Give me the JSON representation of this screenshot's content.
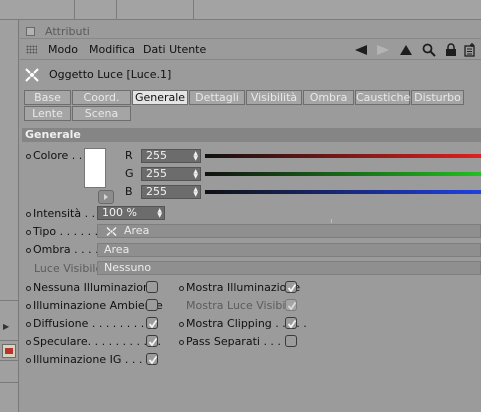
{
  "window": {
    "title": "Attributi"
  },
  "menubar": {
    "items": [
      "Modo",
      "Modifica",
      "Dati Utente"
    ]
  },
  "object": {
    "name": "Oggetto Luce [Luce.1]"
  },
  "tabs": {
    "row1": [
      "Base",
      "Coord.",
      "Generale",
      "Dettagli",
      "Visibilità",
      "Ombra",
      "Caustiche",
      "Disturbo"
    ],
    "row2": [
      "Lente",
      "Scena"
    ],
    "active": "Generale"
  },
  "section": {
    "title": "Generale"
  },
  "color": {
    "label": "Colore . . .",
    "swatch_color": "#ffffff",
    "channels": [
      {
        "name": "R",
        "value": "255",
        "bar_color": "#e02020"
      },
      {
        "name": "G",
        "value": "255",
        "bar_color": "#20c020"
      },
      {
        "name": "B",
        "value": "255",
        "bar_color": "#2040e0"
      }
    ]
  },
  "intensity": {
    "label": "Intensità . . .",
    "value": "100 %"
  },
  "type": {
    "label": "Tipo . . . . . .",
    "value": "Area",
    "icon": "area-light-icon"
  },
  "shadow": {
    "label": "Ombra . . . . .",
    "value": "Area"
  },
  "visible_light": {
    "label": "Luce Visibile",
    "value": "Nessuno"
  },
  "checkboxes": {
    "left": [
      {
        "label": "Nessuna Illuminazione",
        "checked": false
      },
      {
        "label": "Illuminazione Ambiente",
        "checked": false
      },
      {
        "label": "Diffusione . . . . . . . . . .",
        "checked": true
      },
      {
        "label": "Speculare. . . . . . . . . . .",
        "checked": true
      },
      {
        "label": "Illuminazione IG . . . . .",
        "checked": true
      }
    ],
    "right": [
      {
        "label": "Mostra Illuminazione",
        "checked": true,
        "disabled": false
      },
      {
        "label": "Mostra Luce Visibile",
        "checked": true,
        "disabled": true
      },
      {
        "label": "Mostra Clipping . . . . .",
        "checked": true,
        "disabled": false
      },
      {
        "label": "Pass Separati . . . . .",
        "checked": false,
        "disabled": false
      }
    ]
  }
}
